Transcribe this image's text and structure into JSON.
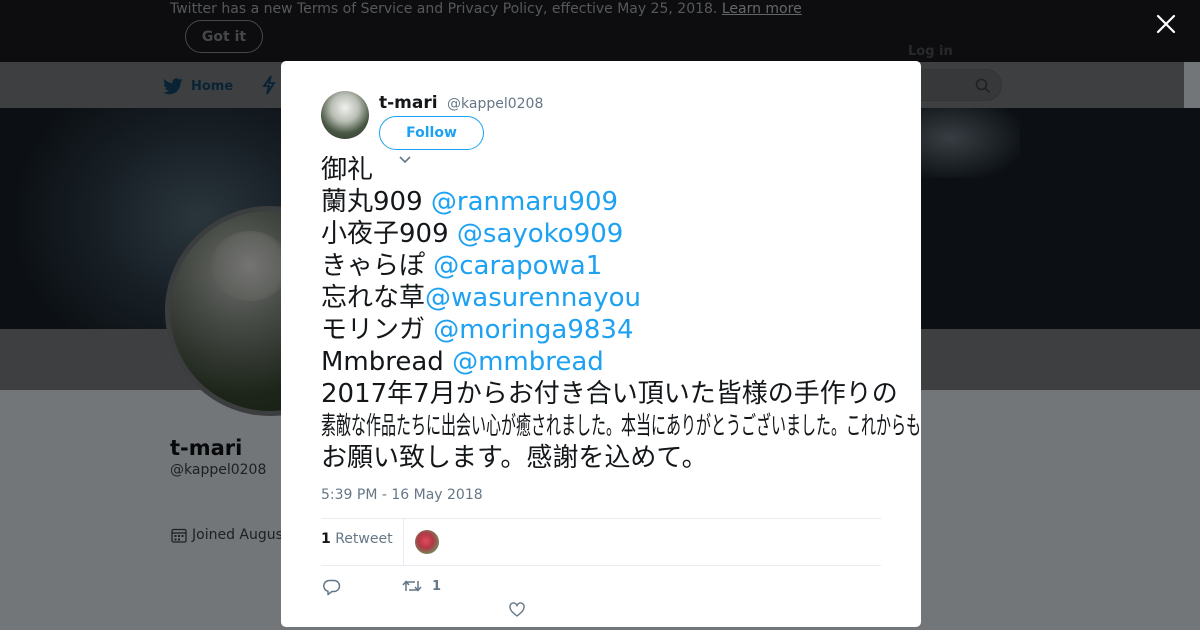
{
  "notice": {
    "text": "Twitter has a new Terms of Service and Privacy Policy, effective May 25, 2018.",
    "link": "Learn more",
    "button": "Got it"
  },
  "nav": {
    "home_label": "Home",
    "login_label": "Log in"
  },
  "profile": {
    "name": "t-mari",
    "handle": "@kappel0208",
    "joined": "Joined Augus"
  },
  "tweet": {
    "name": "t-mari",
    "handle": "@kappel0208",
    "follow_label": "Follow",
    "lines": [
      {
        "text": "御礼",
        "mention": ""
      },
      {
        "text": "蘭丸909 ",
        "mention": "@ranmaru909"
      },
      {
        "text": "小夜子909 ",
        "mention": "@sayoko909"
      },
      {
        "text": "きゃらぽ ",
        "mention": "@carapowa1"
      },
      {
        "text": " 忘れな草",
        "mention": "@wasurennayou"
      },
      {
        "text": "モリンガ ",
        "mention": "@moringa9834"
      },
      {
        "text": "Mmbread ",
        "mention": "@mmbread"
      },
      {
        "text": "2017年7月からお付き合い頂いた皆様の手作りの",
        "mention": ""
      },
      {
        "text": "素敵な作品たちに出会い心が癒されました。本当にありがとうございました。これからも宜しく",
        "mention": ""
      },
      {
        "text": "お願い致します。感謝を込めて。",
        "mention": ""
      }
    ],
    "timestamp": "5:39 PM - 16 May 2018",
    "retweet_count": "1",
    "retweet_label": "Retweet",
    "action_retweet_count": "1"
  },
  "colors": {
    "accent": "#1da1f2",
    "secondary_text": "#657786"
  },
  "icons": [
    "twitter-bird-icon",
    "moments-icon",
    "search-icon",
    "calendar-icon",
    "close-icon",
    "chevron-down-icon",
    "reply-icon",
    "retweet-icon",
    "like-icon"
  ]
}
